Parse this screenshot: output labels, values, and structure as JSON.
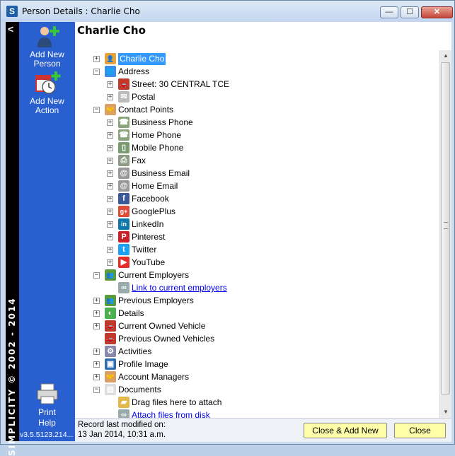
{
  "window": {
    "title": "Person Details : Charlie Cho",
    "app_icon": "S",
    "controls": {
      "minimize": "—",
      "maximize": "☐",
      "close": "✕"
    }
  },
  "sidebar": {
    "collapse_glyph": "<",
    "vertical_text": "SIMPLICITY © 2002 - 2014",
    "buttons": [
      {
        "label": "Add New Person",
        "icon": "add-person-icon"
      },
      {
        "label": "Add New Action",
        "icon": "add-action-icon"
      },
      {
        "label": "Print",
        "icon": "printer-icon"
      },
      {
        "label": "Help",
        "icon": ""
      }
    ],
    "version": "v3.5.5123.214..."
  },
  "main": {
    "title": "Charlie Cho"
  },
  "tree": [
    {
      "label": "Charlie Cho",
      "expander": "+",
      "icon": "person-icon",
      "selected": true
    },
    {
      "label": "Address",
      "expander": "−",
      "icon": "globe-icon"
    },
    {
      "label": "Street:  30 CENTRAL TCE",
      "expander": "+",
      "icon": "car-icon"
    },
    {
      "label": "Postal",
      "expander": "+",
      "icon": "envelope-icon"
    },
    {
      "label": "Contact Points",
      "expander": "−",
      "icon": "handshake-icon"
    },
    {
      "label": "Business Phone",
      "expander": "+",
      "icon": "phone-icon"
    },
    {
      "label": "Home Phone",
      "expander": "+",
      "icon": "phone-icon"
    },
    {
      "label": "Mobile Phone",
      "expander": "+",
      "icon": "mobile-icon"
    },
    {
      "label": "Fax",
      "expander": "+",
      "icon": "fax-icon"
    },
    {
      "label": "Business Email",
      "expander": "+",
      "icon": "at-icon"
    },
    {
      "label": "Home Email",
      "expander": "+",
      "icon": "at-icon"
    },
    {
      "label": "Facebook",
      "expander": "+",
      "icon": "facebook-icon"
    },
    {
      "label": "GooglePlus",
      "expander": "+",
      "icon": "googleplus-icon"
    },
    {
      "label": "LinkedIn",
      "expander": "+",
      "icon": "linkedin-icon"
    },
    {
      "label": "Pinterest",
      "expander": "+",
      "icon": "pinterest-icon"
    },
    {
      "label": "Twitter",
      "expander": "+",
      "icon": "twitter-icon"
    },
    {
      "label": "YouTube",
      "expander": "+",
      "icon": "youtube-icon"
    },
    {
      "label": "Current Employers",
      "expander": "−",
      "icon": "people-icon"
    },
    {
      "label": "Link to current employers",
      "expander": "",
      "icon": "link-icon",
      "link": true
    },
    {
      "label": "Previous Employers",
      "expander": "+",
      "icon": "people-icon"
    },
    {
      "label": "Details",
      "expander": "+",
      "icon": "details-icon"
    },
    {
      "label": "Current Owned Vehicle",
      "expander": "+",
      "icon": "car-icon"
    },
    {
      "label": "Previous Owned Vehicles",
      "expander": "",
      "icon": "car-icon"
    },
    {
      "label": "Activities",
      "expander": "+",
      "icon": "activities-icon"
    },
    {
      "label": "Profile Image",
      "expander": "+",
      "icon": "profile-image-icon"
    },
    {
      "label": "Account Managers",
      "expander": "+",
      "icon": "handshake-icon"
    },
    {
      "label": "Documents",
      "expander": "−",
      "icon": "document-icon"
    },
    {
      "label": "Drag files here to attach",
      "expander": "",
      "icon": "folder-add-icon"
    },
    {
      "label": "Attach files from disk",
      "expander": "",
      "icon": "link-icon",
      "link": true
    }
  ],
  "footer": {
    "record_label": "Record last modified on:",
    "record_date": "13 Jan 2014, 10:31 a.m.",
    "close_add_new": "Close & Add New",
    "close": "Close"
  }
}
